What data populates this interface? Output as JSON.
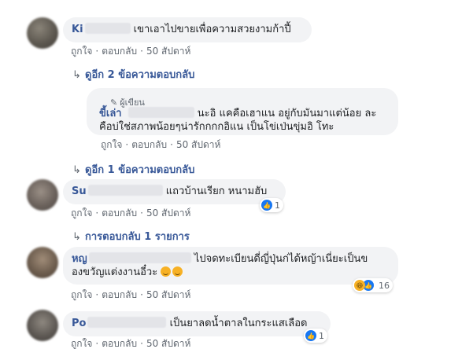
{
  "comments": [
    {
      "name": "Ki",
      "text": "เขาเอาไปขายเพื่อความสวยงามก้าปี้",
      "like_label": "ถูกใจ",
      "reply_label": "ตอบกลับ",
      "time": "50 สัปดาห์",
      "more_replies": "ดูอีก 2 ข้อความตอบกลับ"
    },
    {
      "author_tag": "ผู้เขียน",
      "name": "ขี้เล่า",
      "text_line1": "นะอิ แคคือเฮาแน อยู่กับมันมาแต่น้อย ละ",
      "text_line2": "คือบ่ใช่สภาพน้อยๆน่ารักกกกอิแน เป็นโข่เป่นขุ่มอิ โทะ",
      "like_label": "ถูกใจ",
      "reply_label": "ตอบกลับ",
      "time": "50 สัปดาห์",
      "more_replies": "ดูอีก 1 ข้อความตอบกลับ"
    },
    {
      "name": "Su",
      "text": "แถวบ้านเรียก หนามฮับ",
      "like_label": "ถูกใจ",
      "reply_label": "ตอบกลับ",
      "time": "50 สัปดาห์",
      "reaction_count": "1",
      "more_replies": "การตอบกลับ 1 รายการ"
    },
    {
      "name": "หญ",
      "text_line1": "ไปจดทะเบียนดี่ญี่ปุ่นก่ได้หญ้าเนี่ยะเป็นข",
      "text_line2": "องขวัญแต่งงานอี๋วะ",
      "like_label": "ถูกใจ",
      "reply_label": "ตอบกลับ",
      "time": "50 สัปดาห์",
      "reaction_count": "16"
    },
    {
      "name": "Po",
      "text": "เป็นยาลดน้ำตาลในกระแสเลือด",
      "like_label": "ถูกใจ",
      "reply_label": "ตอบกลับ",
      "time": "50 สัปดาห์",
      "reaction_count": "1"
    }
  ],
  "icons": {
    "reply_arrow": "reply-arrow-icon",
    "like_reaction": "like-icon",
    "haha_reaction": "haha-icon",
    "author_pencil": "pencil-icon",
    "laugh_emoji": "laughing-emoji-icon"
  },
  "colors": {
    "name_link": "#385898",
    "bubble_bg": "#f2f3f5",
    "meta_text": "#606770",
    "like_blue": "#1877f2",
    "haha_yellow": "#f7b125"
  }
}
